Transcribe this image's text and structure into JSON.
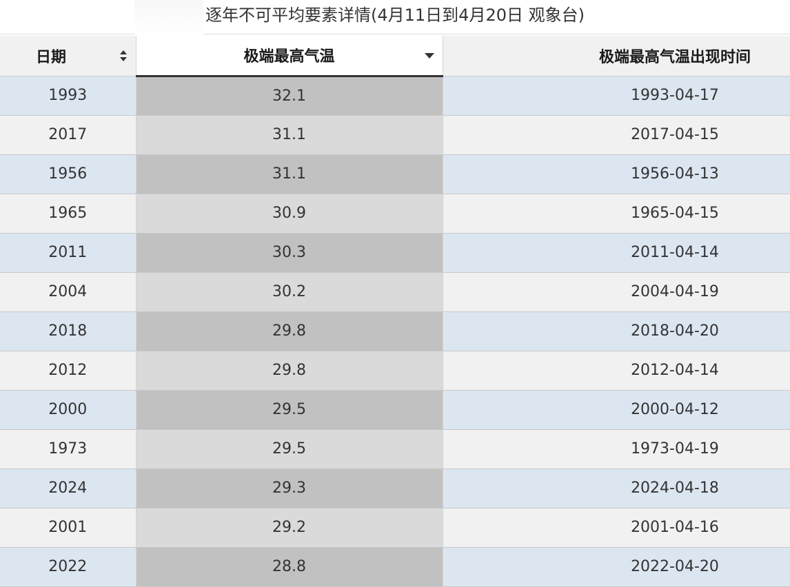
{
  "title": "逐年不可平均要素详情(4月11日到4月20日 观象台)",
  "columns": {
    "date": "日期",
    "max_temp": "极端最高气温",
    "max_temp_time": "极端最高气温出现时间"
  },
  "sort": {
    "column": "max_temp",
    "direction": "descending"
  },
  "rows": [
    {
      "year": "1993",
      "temp": "32.1",
      "time": "1993-04-17"
    },
    {
      "year": "2017",
      "temp": "31.1",
      "time": "2017-04-15"
    },
    {
      "year": "1956",
      "temp": "31.1",
      "time": "1956-04-13"
    },
    {
      "year": "1965",
      "temp": "30.9",
      "time": "1965-04-15"
    },
    {
      "year": "2011",
      "temp": "30.3",
      "time": "2011-04-14"
    },
    {
      "year": "2004",
      "temp": "30.2",
      "time": "2004-04-19"
    },
    {
      "year": "2018",
      "temp": "29.8",
      "time": "2018-04-20"
    },
    {
      "year": "2012",
      "temp": "29.8",
      "time": "2012-04-14"
    },
    {
      "year": "2000",
      "temp": "29.5",
      "time": "2000-04-12"
    },
    {
      "year": "1973",
      "temp": "29.5",
      "time": "1973-04-19"
    },
    {
      "year": "2024",
      "temp": "29.3",
      "time": "2024-04-18"
    },
    {
      "year": "2001",
      "temp": "29.2",
      "time": "2001-04-16"
    },
    {
      "year": "2022",
      "temp": "28.8",
      "time": "2022-04-20"
    }
  ],
  "colors": {
    "row_odd": "#dce6f1",
    "row_even": "#f1f1f1",
    "sorted_col_odd": "#c1c1c1",
    "sorted_col_even": "#dadada",
    "header_bg": "#f1f1f1"
  },
  "icons": {
    "date_sort": "sort-both-icon",
    "temp_sort": "sort-desc-icon"
  }
}
